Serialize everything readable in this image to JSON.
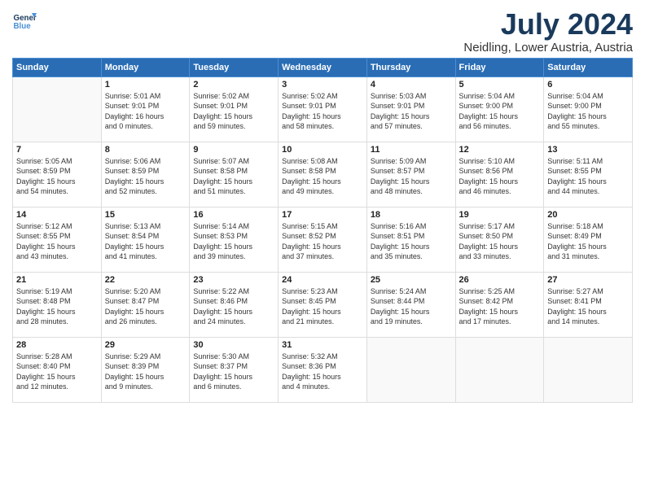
{
  "header": {
    "logo_line1": "General",
    "logo_line2": "Blue",
    "month_title": "July 2024",
    "location": "Neidling, Lower Austria, Austria"
  },
  "weekdays": [
    "Sunday",
    "Monday",
    "Tuesday",
    "Wednesday",
    "Thursday",
    "Friday",
    "Saturday"
  ],
  "weeks": [
    [
      {
        "day": "",
        "info": ""
      },
      {
        "day": "1",
        "info": "Sunrise: 5:01 AM\nSunset: 9:01 PM\nDaylight: 16 hours\nand 0 minutes."
      },
      {
        "day": "2",
        "info": "Sunrise: 5:02 AM\nSunset: 9:01 PM\nDaylight: 15 hours\nand 59 minutes."
      },
      {
        "day": "3",
        "info": "Sunrise: 5:02 AM\nSunset: 9:01 PM\nDaylight: 15 hours\nand 58 minutes."
      },
      {
        "day": "4",
        "info": "Sunrise: 5:03 AM\nSunset: 9:01 PM\nDaylight: 15 hours\nand 57 minutes."
      },
      {
        "day": "5",
        "info": "Sunrise: 5:04 AM\nSunset: 9:00 PM\nDaylight: 15 hours\nand 56 minutes."
      },
      {
        "day": "6",
        "info": "Sunrise: 5:04 AM\nSunset: 9:00 PM\nDaylight: 15 hours\nand 55 minutes."
      }
    ],
    [
      {
        "day": "7",
        "info": "Sunrise: 5:05 AM\nSunset: 8:59 PM\nDaylight: 15 hours\nand 54 minutes."
      },
      {
        "day": "8",
        "info": "Sunrise: 5:06 AM\nSunset: 8:59 PM\nDaylight: 15 hours\nand 52 minutes."
      },
      {
        "day": "9",
        "info": "Sunrise: 5:07 AM\nSunset: 8:58 PM\nDaylight: 15 hours\nand 51 minutes."
      },
      {
        "day": "10",
        "info": "Sunrise: 5:08 AM\nSunset: 8:58 PM\nDaylight: 15 hours\nand 49 minutes."
      },
      {
        "day": "11",
        "info": "Sunrise: 5:09 AM\nSunset: 8:57 PM\nDaylight: 15 hours\nand 48 minutes."
      },
      {
        "day": "12",
        "info": "Sunrise: 5:10 AM\nSunset: 8:56 PM\nDaylight: 15 hours\nand 46 minutes."
      },
      {
        "day": "13",
        "info": "Sunrise: 5:11 AM\nSunset: 8:55 PM\nDaylight: 15 hours\nand 44 minutes."
      }
    ],
    [
      {
        "day": "14",
        "info": "Sunrise: 5:12 AM\nSunset: 8:55 PM\nDaylight: 15 hours\nand 43 minutes."
      },
      {
        "day": "15",
        "info": "Sunrise: 5:13 AM\nSunset: 8:54 PM\nDaylight: 15 hours\nand 41 minutes."
      },
      {
        "day": "16",
        "info": "Sunrise: 5:14 AM\nSunset: 8:53 PM\nDaylight: 15 hours\nand 39 minutes."
      },
      {
        "day": "17",
        "info": "Sunrise: 5:15 AM\nSunset: 8:52 PM\nDaylight: 15 hours\nand 37 minutes."
      },
      {
        "day": "18",
        "info": "Sunrise: 5:16 AM\nSunset: 8:51 PM\nDaylight: 15 hours\nand 35 minutes."
      },
      {
        "day": "19",
        "info": "Sunrise: 5:17 AM\nSunset: 8:50 PM\nDaylight: 15 hours\nand 33 minutes."
      },
      {
        "day": "20",
        "info": "Sunrise: 5:18 AM\nSunset: 8:49 PM\nDaylight: 15 hours\nand 31 minutes."
      }
    ],
    [
      {
        "day": "21",
        "info": "Sunrise: 5:19 AM\nSunset: 8:48 PM\nDaylight: 15 hours\nand 28 minutes."
      },
      {
        "day": "22",
        "info": "Sunrise: 5:20 AM\nSunset: 8:47 PM\nDaylight: 15 hours\nand 26 minutes."
      },
      {
        "day": "23",
        "info": "Sunrise: 5:22 AM\nSunset: 8:46 PM\nDaylight: 15 hours\nand 24 minutes."
      },
      {
        "day": "24",
        "info": "Sunrise: 5:23 AM\nSunset: 8:45 PM\nDaylight: 15 hours\nand 21 minutes."
      },
      {
        "day": "25",
        "info": "Sunrise: 5:24 AM\nSunset: 8:44 PM\nDaylight: 15 hours\nand 19 minutes."
      },
      {
        "day": "26",
        "info": "Sunrise: 5:25 AM\nSunset: 8:42 PM\nDaylight: 15 hours\nand 17 minutes."
      },
      {
        "day": "27",
        "info": "Sunrise: 5:27 AM\nSunset: 8:41 PM\nDaylight: 15 hours\nand 14 minutes."
      }
    ],
    [
      {
        "day": "28",
        "info": "Sunrise: 5:28 AM\nSunset: 8:40 PM\nDaylight: 15 hours\nand 12 minutes."
      },
      {
        "day": "29",
        "info": "Sunrise: 5:29 AM\nSunset: 8:39 PM\nDaylight: 15 hours\nand 9 minutes."
      },
      {
        "day": "30",
        "info": "Sunrise: 5:30 AM\nSunset: 8:37 PM\nDaylight: 15 hours\nand 6 minutes."
      },
      {
        "day": "31",
        "info": "Sunrise: 5:32 AM\nSunset: 8:36 PM\nDaylight: 15 hours\nand 4 minutes."
      },
      {
        "day": "",
        "info": ""
      },
      {
        "day": "",
        "info": ""
      },
      {
        "day": "",
        "info": ""
      }
    ]
  ]
}
